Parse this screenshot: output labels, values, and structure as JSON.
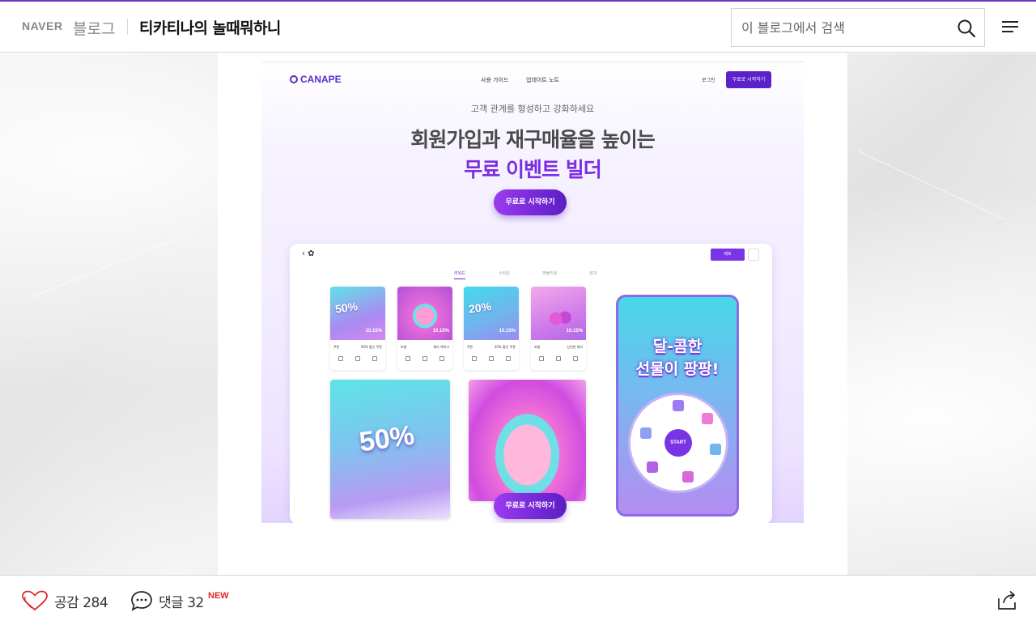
{
  "header": {
    "naver_label": "NAVER",
    "blog_label": "블로그",
    "blog_title": "티카티나의 놀때뭐하니",
    "search_placeholder": "이 블로그에서 검색",
    "accent_color": "#6a3db8"
  },
  "embedded_page": {
    "logo": "CANAPE",
    "nav_links": [
      "사용 가이드",
      "업데이트 노트"
    ],
    "login": "로그인",
    "top_cta": "무료로 시작하기",
    "tagline": "고객 관계를 형성하고 강화하세요",
    "headline_1": "회원가입과 재구매율을 높이는",
    "headline_2": "무료 이벤트 빌더",
    "cta": "무료로 시작하기",
    "builder": {
      "save": "배포",
      "tabs": [
        "리워드",
        "스타일",
        "퍼블리싱",
        "성과"
      ],
      "tiles": [
        {
          "big": "50%",
          "pct": "10.15%",
          "type": "쿠폰",
          "name": "50% 할인 쿠폰"
        },
        {
          "big": "",
          "pct": "10.15%",
          "type": "보물",
          "name": "체리 케이크"
        },
        {
          "big": "20%",
          "pct": "10.15%",
          "type": "쿠폰",
          "name": "20% 할인 쿠폰"
        },
        {
          "big": "",
          "pct": "10.15%",
          "type": "보물",
          "name": "신선한 체리"
        }
      ],
      "card_big": "50%",
      "phone_line_1": "달-콤한",
      "phone_line_2": "선물이 팡팡!",
      "wheel_start": "START"
    },
    "brand_color": "#7b2ee0"
  },
  "footer": {
    "like_label": "공감",
    "like_count": "284",
    "comment_label": "댓글",
    "comment_count": "32",
    "new_badge": "NEW"
  }
}
